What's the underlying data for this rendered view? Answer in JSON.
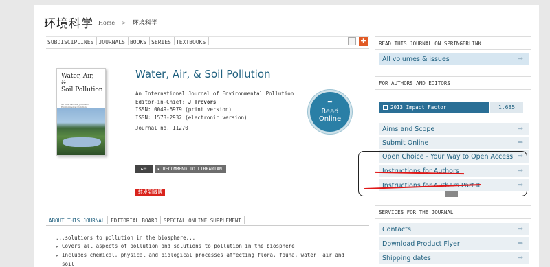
{
  "header": {
    "site_title": "环境科学",
    "breadcrumb_home": "Home",
    "breadcrumb_sep": ">",
    "breadcrumb_current": "环境科学"
  },
  "subnav": {
    "items": [
      "SUBDISCIPLINES",
      "JOURNALS",
      "BOOKS",
      "SERIES",
      "TEXTBOOKS"
    ],
    "share_icon": "plus-icon",
    "share_label": "+"
  },
  "journal": {
    "title": "Water, Air, & Soil Pollution",
    "cover_title_lines": [
      "Water, Air,",
      "&",
      "Soil Pollution"
    ],
    "cover_subtitle": "An International Journal of Environmental Pollution",
    "subtitle": "An International Journal of Environmental Pollution",
    "editor_label": "Editor-in-Chief:",
    "editor_name": "J Trevors",
    "issn_print": "ISSN: 0049-6979 (print version)",
    "issn_electronic": "ISSN: 1573-2932 (electronic version)",
    "journal_no": "Journal no. 11270",
    "read_online_line1": "Read",
    "read_online_line2": "Online",
    "recommend_label": "RECOMMEND TO LIBRARIAN",
    "weibo_label": "转发到微博"
  },
  "tabs": [
    "ABOUT THIS JOURNAL",
    "EDITORIAL BOARD",
    "SPECIAL ONLINE SUPPLEMENT"
  ],
  "about": {
    "intro": "...solutions to pollution in the biosphere...",
    "bullets": [
      "Covers all aspects of pollution and solutions to pollution in the biosphere",
      "Includes chemical, physical and biological processes affecting flora, fauna, water, air and"
    ],
    "continuation": "soil"
  },
  "sidebar": {
    "read_section_title": "READ THIS JOURNAL ON SPRINGERLINK",
    "all_volumes": "All volumes & issues",
    "authors_section_title": "FOR AUTHORS AND EDITORS",
    "impact_label": "2013 Impact Factor",
    "impact_value": "1.685",
    "author_links": [
      "Aims and Scope",
      "Submit Online",
      "Open Choice - Your Way to Open Access",
      "Instructions for Authors",
      "Instructions for Authors Part II"
    ],
    "services_section_title": "SERVICES FOR THE JOURNAL",
    "service_links": [
      "Contacts",
      "Download Product Flyer",
      "Shipping dates"
    ]
  },
  "colors": {
    "accent": "#1e5f7e",
    "impact_bar": "#2a6f96",
    "annotation_red": "#e01818"
  }
}
